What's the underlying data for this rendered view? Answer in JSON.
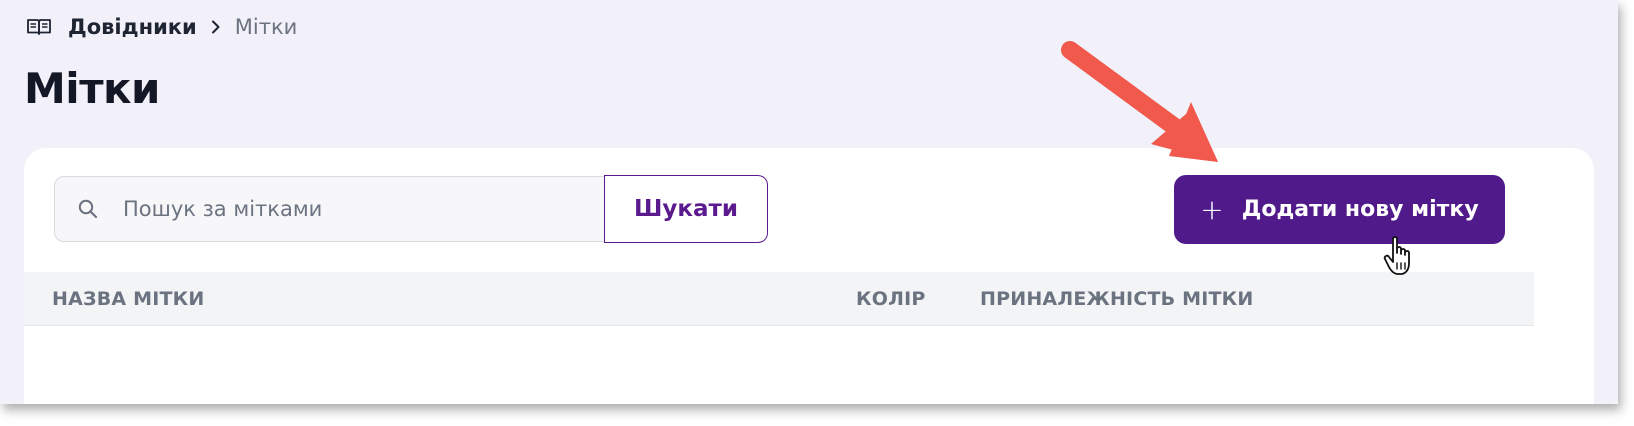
{
  "breadcrumb": {
    "root": "Довідники",
    "current": "Мітки",
    "root_icon": "book-icon",
    "separator_icon": "chevron-right-icon"
  },
  "page": {
    "title": "Мітки"
  },
  "search": {
    "placeholder": "Пошук за мітками",
    "value": "",
    "icon": "search-icon",
    "button_label": "Шукати"
  },
  "toolbar": {
    "add_label": "Додати нову мітку",
    "add_icon": "plus-icon"
  },
  "table": {
    "columns": [
      "НАЗВА МІТКИ",
      "КОЛІР",
      "ПРИНАЛЕЖНІСТЬ МІТКИ"
    ],
    "rows": []
  },
  "colors": {
    "accent": "#511a8a",
    "annotation_arrow": "#f0594b",
    "background": "#f2f0f9"
  }
}
